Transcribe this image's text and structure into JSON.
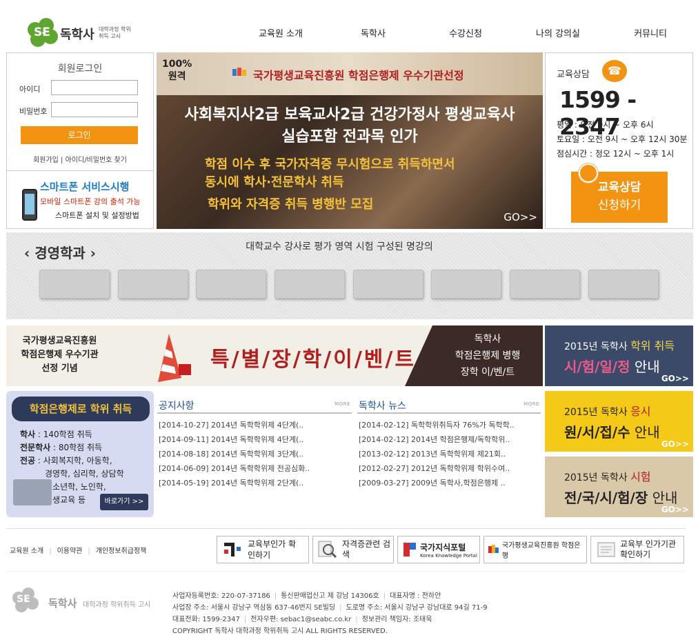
{
  "header": {
    "logo_se": "SE",
    "logo_name": "독학사",
    "logo_sub": "대학과정 학위취득 고시",
    "nav": [
      "교육원 소개",
      "독학사",
      "수강신청",
      "나의 강의실",
      "커뮤니티"
    ]
  },
  "login": {
    "title": "회원로그인",
    "id_label": "아이디",
    "pw_label": "비밀번호",
    "id_value": "",
    "pw_value": "",
    "button": "로그인",
    "links": "회원가입 | 아이디/비밀번호 찾기"
  },
  "smartphone": {
    "title": "스마트폰 서비스시행",
    "line1": "모바일 스마트폰 강의 출석 가능",
    "line2": "스마트폰 설치 및 설정방법"
  },
  "main_banner": {
    "badge_line1": "100%",
    "badge_line2": "원격",
    "top": "국가평생교육진흥원 학점은행제 우수기관선정",
    "line1": "사회복지사2급  보육교사2급  건강가정사  평생교육사",
    "line2": "실습포함 전과목 인가",
    "line3": "학점 이수 후 국가자격증 무시험으로 취득하면서",
    "line4": "동시에 학사·전문학사 취득",
    "line5": "학위와 자격증 취득 병행반 모집",
    "go": "GO>>"
  },
  "consult": {
    "title": "교육상담",
    "number": "1599 - 2347",
    "hours": [
      "평일 : 오전 9시 ~ 오후 6시",
      "토요일 : 오전 9시 ~ 오후 12시 30분",
      "점심시간 : 정오 12시 ~ 오후 1시"
    ],
    "button_line1": "교육상담",
    "button_line2": "신청하기"
  },
  "dept": {
    "title": "‹ 경영학과 ›",
    "subtitle": "대학교수 강사로 평가 영역 시험 구성된 명강의"
  },
  "event": {
    "left_line1": "국가평생교육진흥원",
    "left_line2": "학점은행제 우수기관",
    "left_line3": "선정 기념",
    "center": "특/별/장/학/이/벤/트",
    "right_line1": "독학사",
    "right_line2": "학점은행제 병행",
    "right_line3": "장학 이/벤/트"
  },
  "side_banners": [
    {
      "year": "2015년 독학사",
      "highlight": "학위 취득",
      "main_b": "시/험/일/정",
      "main": " 안내",
      "go": "GO>>"
    },
    {
      "year": "2015년 독학사",
      "highlight": "응시",
      "main_b": "원/서/접/수",
      "main": " 안내",
      "go": "GO>>"
    },
    {
      "year": "2015년 독학사",
      "highlight": "시험",
      "main_b": "전/국/시/험/장",
      "main": " 안내",
      "go": "GO>>"
    }
  ],
  "credit_promo": {
    "title": "학점은행제로 학위 취득",
    "r1_label": "학사",
    "r1_value": " : 140학점 취득",
    "r2_label": "전문학사",
    "r2_value": " : 80학점 취득",
    "r3_label": "전공",
    "r3_value": " : 사회복지학, 아동학,",
    "r4": "경영학, 심리학, 상담학",
    "r5": "청소년학, 노인학,",
    "r6": "평생교육 등",
    "go": "바로가기 >>"
  },
  "notice": {
    "title": "공지사항",
    "more": "MORE",
    "items": [
      "[2014-10-27] 2014년 독학학위제 4단계(..",
      "[2014-09-11] 2014년 독학학위제 4단계(..",
      "[2014-08-18] 2014년 독학학위제 3단계(..",
      "[2014-06-09] 2014년 독학학위제 전공심화..",
      "[2014-05-19] 2014년 독학학위제 2단계(.."
    ]
  },
  "news": {
    "title": "독학사 뉴스",
    "more": "MORE",
    "items": [
      "[2014-02-12] 독학학위취득자 76%가 독학학..",
      "[2014-02-12] 2014년 학점은행제/독학학위..",
      "[2013-02-12] 2013년 독학학위제 제21회..",
      "[2012-02-27] 2012년 독학학위제 학위수여..",
      "[2009-03-27] 2009년 독학사,학점은행제 .."
    ]
  },
  "footer": {
    "nav": [
      "교육원 소개",
      "이용약관",
      "개인정보취급정책"
    ],
    "banners": [
      "교육부인가 확인하기",
      "자격증관련 검색",
      "국가지식포털",
      "국가평생교육진흥원 학점은행",
      "교육부 인가기관 확인하기"
    ],
    "banner_sub3": "Korea Knowledge Portal",
    "logo_name": "독학사",
    "logo_sub": "대학과정 학위취득 고시",
    "info1": [
      "사업자등록번호: 220-07-37186",
      "통신판매업신고 제 강남 14306호",
      "대표자명 : 전하얀"
    ],
    "info2": [
      "사업장 주소: 서울시 강남구 역삼동 637-46번지 SE빌딩",
      "도로명 주소: 서울시 강남구 강남대로 94길 71-9"
    ],
    "info3": [
      "대표전화: 1599-2347",
      "전자우편: sebac1@seabc.co.kr",
      "정보관리 책임자: 조태욱"
    ],
    "copyright": "COPYRIGHT  독학사 대학과정 학위취득 고시  ALL RIGHTS RESERVED."
  }
}
